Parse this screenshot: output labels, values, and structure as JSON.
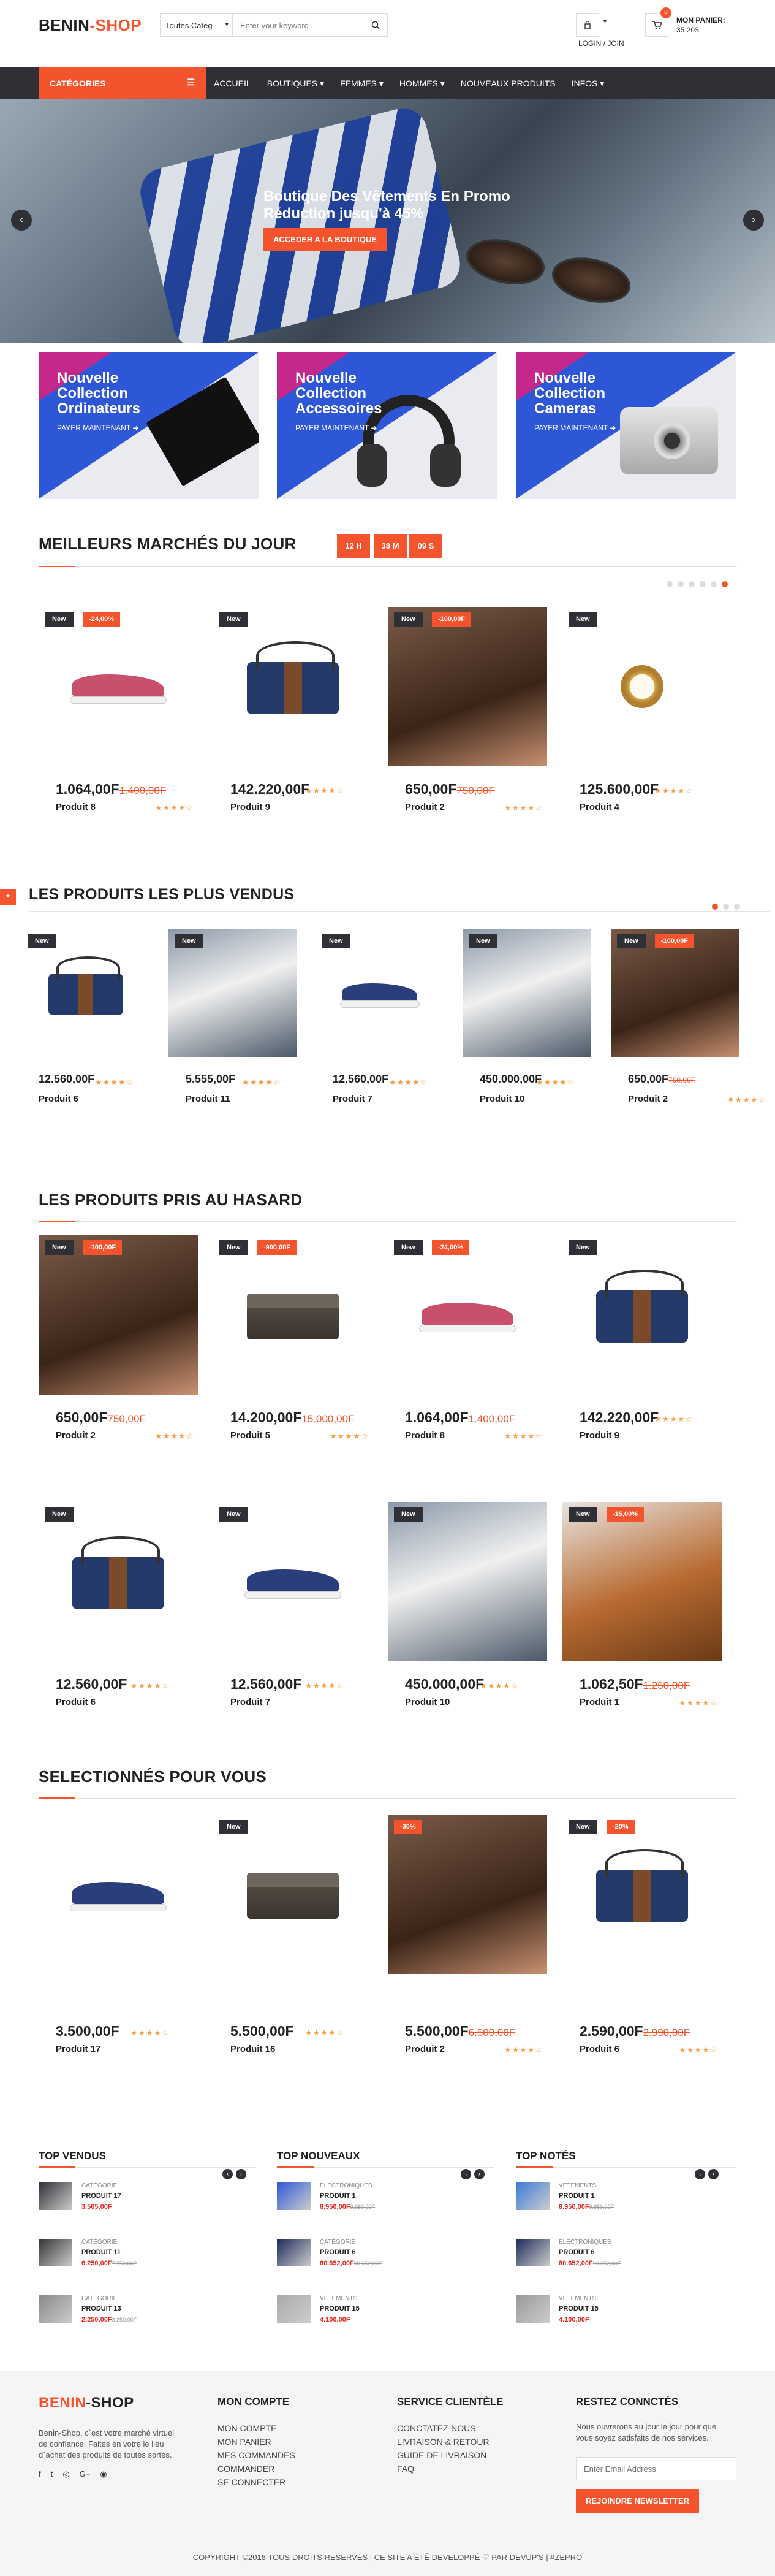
{
  "header": {
    "logo_a": "BENIN",
    "logo_b": "-SHOP",
    "search_select": "Toutes Categ",
    "search_placeholder": "Enter your keyword",
    "login": "LOGIN / JOIN",
    "cart_count": "0",
    "cart_label": "MON PANIER:",
    "cart_total": "35.20$"
  },
  "nav": {
    "categories": "CATÉGORIES",
    "items": [
      {
        "label": "ACCUEIL"
      },
      {
        "label": "BOUTIQUES ▾"
      },
      {
        "label": "FEMMES ▾"
      },
      {
        "label": "HOMMES ▾"
      },
      {
        "label": "NOUVEAUX PRODUITS"
      },
      {
        "label": "INFOS ▾"
      }
    ]
  },
  "hero": {
    "line1": "Boutique Des Vêtements En Promo",
    "line2": "Réduction jusqu'à 45%",
    "button": "ACCEDER A LA BOUTIQUE"
  },
  "banners": [
    {
      "title": "Nouvelle Collection Ordinateurs",
      "cta": "PAYER MAINTENANT"
    },
    {
      "title": "Nouvelle Collection Accessoires",
      "cta": "PAYER MAINTENANT"
    },
    {
      "title": "Nouvelle Collection Cameras",
      "cta": "PAYER MAINTENANT"
    }
  ],
  "deals": {
    "title": "MEILLEURS MARCHÉS DU JOUR",
    "timer": [
      "12 H",
      "38 M",
      "09 S"
    ],
    "products": [
      {
        "new": "New",
        "sale": "-24,00%",
        "price": "1.064,00F",
        "old": "1.400,00F",
        "name": "Produit 8",
        "rating": 4
      },
      {
        "new": "New",
        "sale": "",
        "price": "142.220,00F",
        "old": "",
        "name": "Produit 9",
        "rating": 4
      },
      {
        "new": "New",
        "sale": "-100,00F",
        "price": "650,00F",
        "old": "750,00F",
        "name": "Produit 2",
        "rating": 4
      },
      {
        "new": "New",
        "sale": "",
        "price": "125.600,00F",
        "old": "",
        "name": "Produit 4",
        "rating": 4
      }
    ]
  },
  "bestsellers": {
    "title": "LES PRODUITS LES PLUS VENDUS",
    "products": [
      {
        "new": "New",
        "sale": "",
        "price": "12.560,00F",
        "old": "",
        "name": "Produit 6",
        "rating": 4
      },
      {
        "new": "New",
        "sale": "",
        "price": "5.555,00F",
        "old": "",
        "name": "Produit 11",
        "rating": 4
      },
      {
        "new": "New",
        "sale": "",
        "price": "12.560,00F",
        "old": "",
        "name": "Produit 7",
        "rating": 4
      },
      {
        "new": "New",
        "sale": "",
        "price": "450.000,00F",
        "old": "",
        "name": "Produit 10",
        "rating": 4
      },
      {
        "new": "New",
        "sale": "-100,00F",
        "price": "650,00F",
        "old": "750,00F",
        "name": "Produit 2",
        "rating": 4
      }
    ]
  },
  "random": {
    "title": "LES PRODUITS PRIS AU HASARD",
    "products": [
      {
        "new": "New",
        "sale": "-100,00F",
        "price": "650,00F",
        "old": "750,00F",
        "name": "Produit 2",
        "rating": 4
      },
      {
        "new": "New",
        "sale": "-900,00F",
        "price": "14.200,00F",
        "old": "15.000,00F",
        "name": "Produit 5",
        "rating": 4
      },
      {
        "new": "New",
        "sale": "-24,00%",
        "price": "1.064,00F",
        "old": "1.400,00F",
        "name": "Produit 8",
        "rating": 4
      },
      {
        "new": "New",
        "sale": "",
        "price": "142.220,00F",
        "old": "",
        "name": "Produit 9",
        "rating": 4
      },
      {
        "new": "New",
        "sale": "",
        "price": "12.560,00F",
        "old": "",
        "name": "Produit 6",
        "rating": 4
      },
      {
        "new": "New",
        "sale": "",
        "price": "12.560,00F",
        "old": "",
        "name": "Produit 7",
        "rating": 4
      },
      {
        "new": "New",
        "sale": "",
        "price": "450.000,00F",
        "old": "",
        "name": "Produit 10",
        "rating": 4
      },
      {
        "new": "New",
        "sale": "-15,00%",
        "price": "1.062,50F",
        "old": "1.250,00F",
        "name": "Produit 1",
        "rating": 4
      }
    ]
  },
  "selected": {
    "title": "SELECTIONNÉS POUR VOUS",
    "products": [
      {
        "new": "",
        "sale": "",
        "price": "3.500,00F",
        "old": "",
        "name": "Produit 17",
        "rating": 4
      },
      {
        "new": "New",
        "sale": "",
        "price": "5.500,00F",
        "old": "",
        "name": "Produit 16",
        "rating": 4
      },
      {
        "new": "",
        "sale": "-30%",
        "price": "5.500,00F",
        "old": "6.500,00F",
        "name": "Produit 2",
        "rating": 4
      },
      {
        "new": "New",
        "sale": "-20%",
        "price": "2.590,00F",
        "old": "2.990,00F",
        "name": "Produit 6",
        "rating": 4
      }
    ]
  },
  "lists": [
    {
      "title": "TOP VENDUS",
      "items": [
        {
          "cat": "CATÉGORIE",
          "name": "PRODUIT 17",
          "price": "3.505,00F",
          "old": ""
        },
        {
          "cat": "CATÉGORIE",
          "name": "PRODUIT 11",
          "price": "6.250,00F",
          "old": "7.750,00F"
        },
        {
          "cat": "CATÉGORIE",
          "name": "PRODUIT 13",
          "price": "2.250,00F",
          "old": "3.250,00F"
        }
      ]
    },
    {
      "title": "TOP NOUVEAUX",
      "items": [
        {
          "cat": "ÉLECTRONIQUES",
          "name": "PRODUIT 1",
          "price": "8.950,00F",
          "old": "9.950,00F"
        },
        {
          "cat": "CATÉGORIE",
          "name": "PRODUIT 6",
          "price": "80.652,00F",
          "old": "90.652,00F"
        },
        {
          "cat": "VÊTEMENTS",
          "name": "PRODUIT 15",
          "price": "4.100,00F",
          "old": ""
        }
      ]
    },
    {
      "title": "TOP NOTÉS",
      "items": [
        {
          "cat": "VÊTEMENTS",
          "name": "PRODUIT 1",
          "price": "8.950,00F",
          "old": "9.950,00F"
        },
        {
          "cat": "ÉLECTRONIQUES",
          "name": "PRODUIT 6",
          "price": "80.652,00F",
          "old": "90.652,00F"
        },
        {
          "cat": "VÊTEMENTS",
          "name": "PRODUIT 15",
          "price": "4.100,00F",
          "old": ""
        }
      ]
    }
  ],
  "footer": {
    "about": "Benin-Shop, c`est votre marché virtuel de confiance. Faites en votre le lieu d`achat des produits de toutes sortes.",
    "social": [
      "f",
      "t",
      "◎",
      "G+",
      "◉"
    ],
    "account_title": "MON COMPTE",
    "account_links": [
      "MON COMPTE",
      "MON PANIER",
      "MES COMMANDES",
      "COMMANDER",
      "SE CONNECTER"
    ],
    "service_title": "SERVICE CLIENTÈLE",
    "service_links": [
      "CONCTATEZ-NOUS",
      "LIVRAISON & RETOUR",
      "GUIDE DE LIVRAISON",
      "FAQ"
    ],
    "news_title": "RESTEZ CONNCTÉS",
    "news_text": "Nous ouvrerons au jour le jour pour que vous soyez satisfaits de nos services.",
    "news_placeholder": "Enter Email Address",
    "news_button": "REJOINDRE NEWSLETTER",
    "copyright": "COPYRIGHT ©2018 TOUS DROITS RESERVÉS | CE SITE A ÉTÉ DEVELOPPÉ ♡ PAR DEVUP'S | #ZEPRO"
  },
  "colors": {
    "accent": "#f4542d",
    "dark": "#2e3035",
    "blue": "#2e57d8"
  }
}
